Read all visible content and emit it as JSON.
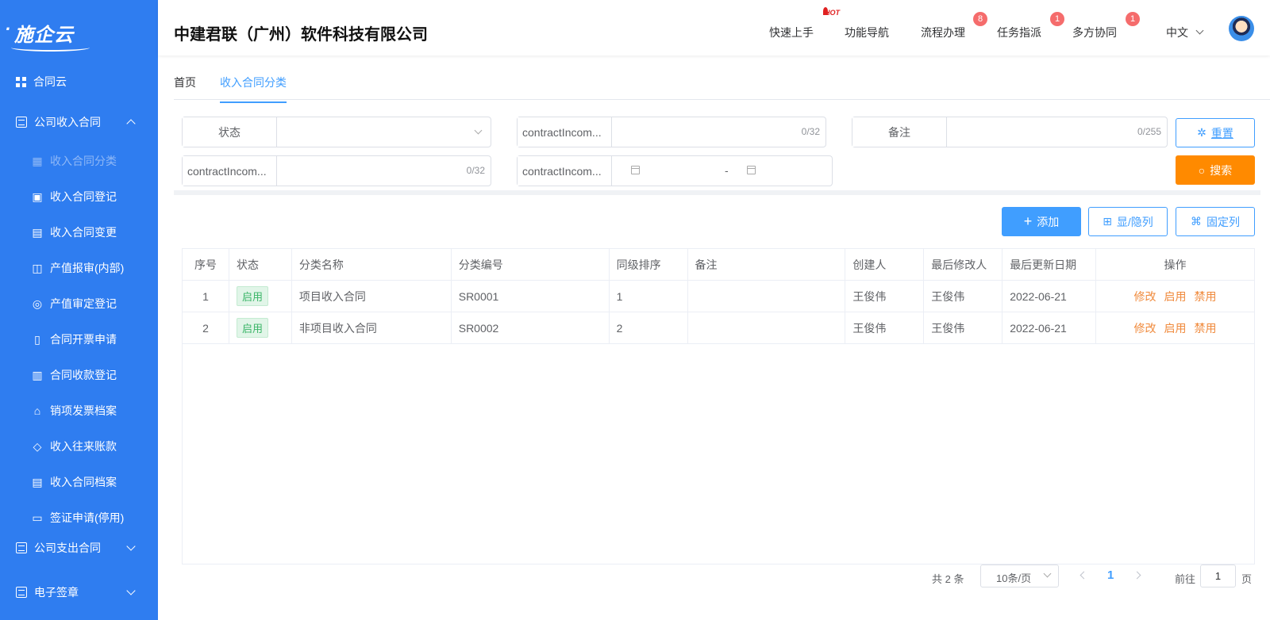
{
  "app": {
    "logo_text": "施企云",
    "company": "中建君联（广州）软件科技有限公司"
  },
  "header": {
    "nav": [
      {
        "label": "快速上手",
        "badge": ""
      },
      {
        "label": "功能导航",
        "badge": ""
      },
      {
        "label": "流程办理",
        "badge": "8"
      },
      {
        "label": "任务指派",
        "badge": "1"
      },
      {
        "label": "多方协同",
        "badge": "1"
      }
    ],
    "hot_label": "HOT",
    "language": "中文"
  },
  "sidebar": {
    "top_item": "合同云",
    "group_income": "公司收入合同",
    "sub_items": [
      {
        "label": "收入合同分类",
        "icon": "grid-icon"
      },
      {
        "label": "收入合同登记",
        "icon": "id-card-icon"
      },
      {
        "label": "收入合同变更",
        "icon": "doc-change-icon"
      },
      {
        "label": "产值报审(内部)",
        "icon": "report-icon"
      },
      {
        "label": "产值审定登记",
        "icon": "coin-icon"
      },
      {
        "label": "合同开票申请",
        "icon": "clipboard-icon"
      },
      {
        "label": "合同收款登记",
        "icon": "calendar-list-icon"
      },
      {
        "label": "销项发票档案",
        "icon": "house-doc-icon"
      },
      {
        "label": "收入往来账款",
        "icon": "cube-icon"
      },
      {
        "label": "收入合同档案",
        "icon": "archive-icon"
      },
      {
        "label": "签证申请(停用)",
        "icon": "doc-export-icon"
      }
    ],
    "group_expense": "公司支出合同",
    "group_esign": "电子签章"
  },
  "tabs": [
    {
      "label": "首页"
    },
    {
      "label": "收入合同分类"
    }
  ],
  "filter": {
    "status_label": "状态",
    "field2_label": "contractIncom...",
    "field2_count": "0/32",
    "remark_label": "备注",
    "remark_count": "0/255",
    "field4_label": "contractIncom...",
    "field4_count": "0/32",
    "field5_label": "contractIncom...",
    "date_sep": "-",
    "reset_label": "重置",
    "search_label": "搜索"
  },
  "toolbar": {
    "add_label": "添加",
    "toggle_cols_label": "显/隐列",
    "fix_cols_label": "固定列"
  },
  "table": {
    "headers": [
      "序号",
      "状态",
      "分类名称",
      "分类编号",
      "同级排序",
      "备注",
      "创建人",
      "最后修改人",
      "最后更新日期",
      "操作"
    ],
    "rows": [
      {
        "index": "1",
        "status": "启用",
        "name": "项目收入合同",
        "code": "SR0001",
        "sort": "1",
        "remark": "",
        "creator": "王俊伟",
        "modifier": "王俊伟",
        "date": "2022-06-21",
        "ops": [
          "修改",
          "启用",
          "禁用"
        ]
      },
      {
        "index": "2",
        "status": "启用",
        "name": "非项目收入合同",
        "code": "SR0002",
        "sort": "2",
        "remark": "",
        "creator": "王俊伟",
        "modifier": "王俊伟",
        "date": "2022-06-21",
        "ops": [
          "修改",
          "启用",
          "禁用"
        ]
      }
    ]
  },
  "pagination": {
    "total_text": "共 2 条",
    "page_size": "10条/页",
    "current_page": "1",
    "goto_prefix": "前往",
    "goto_value": "1",
    "goto_suffix": "页"
  },
  "colors": {
    "sidebar_bg": "#2f7df0",
    "primary": "#409eff",
    "search_orange": "#ff8a00",
    "badge_red": "#f56c6c",
    "op_orange": "#f08a3c",
    "tag_green": "#3ab567"
  }
}
